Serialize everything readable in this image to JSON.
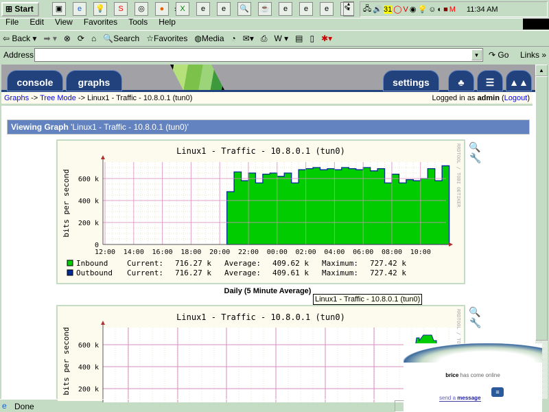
{
  "taskbar": {
    "start": "Start",
    "clock": "11:34 AM",
    "chevron": "»"
  },
  "menu": [
    "File",
    "Edit",
    "View",
    "Favorites",
    "Tools",
    "Help"
  ],
  "toolbar": {
    "back": "Back",
    "search": "Search",
    "favorites": "Favorites",
    "media": "Media"
  },
  "address": {
    "label": "Address",
    "value": "",
    "go": "Go",
    "links": "Links"
  },
  "tabs": {
    "console": "console",
    "graphs": "graphs",
    "settings": "settings"
  },
  "breadcrumb": {
    "graphs": "Graphs",
    "sep": "->",
    "tree": "Tree Mode",
    "current": "Linux1 - Traffic - 10.8.0.1 (tun0)",
    "logged_prefix": "Logged in as",
    "user": "admin",
    "logout": "Logout"
  },
  "viewing": {
    "label": "Viewing Graph",
    "title": "'Linux1 - Traffic - 10.8.0.1 (tun0)'"
  },
  "graph1": {
    "caption": "Daily (5 Minute Average)",
    "watermark": "RRDTOOL / TOBI OETIKER"
  },
  "tooltip": "Linux1 - Traffic - 10.8.0.1 (tun0)",
  "popup": {
    "user": "brice",
    "text": "has come online",
    "send": "send a",
    "message": "message"
  },
  "status": {
    "text": "Done"
  },
  "colors": {
    "inbound": "#00cc00",
    "outbound": "#002a97",
    "header_bar": "#6383c0",
    "tab": "#22427e"
  },
  "chart_data": [
    {
      "type": "area",
      "title": "Linux1 - Traffic - 10.8.0.1 (tun0)",
      "ylabel": "bits per second",
      "yticks": [
        "0",
        "200 k",
        "400 k",
        "600 k"
      ],
      "ylim": [
        0,
        750000
      ],
      "xticks": [
        "12:00",
        "14:00",
        "16:00",
        "18:00",
        "20:00",
        "22:00",
        "00:00",
        "02:00",
        "04:00",
        "06:00",
        "08:00",
        "10:00"
      ],
      "x_start": "20:30",
      "x_step_minutes": 30,
      "series": [
        {
          "name": "Inbound",
          "values": [
            480,
            660,
            580,
            650,
            560,
            640,
            650,
            620,
            650,
            560,
            680,
            690,
            700,
            680,
            690,
            680,
            700,
            690,
            680,
            700,
            670,
            690,
            560,
            640,
            560,
            590,
            580,
            600,
            690,
            580,
            716
          ]
        }
      ],
      "legend": [
        {
          "name": "Inbound",
          "current": "716.27 k",
          "average": "409.62 k",
          "maximum": "727.42 k"
        },
        {
          "name": "Outbound",
          "current": "716.27 k",
          "average": "409.61 k",
          "maximum": "727.42 k"
        }
      ],
      "legend_labels": {
        "current": "Current:",
        "average": "Average:",
        "maximum": "Maximum:"
      }
    },
    {
      "type": "area",
      "title": "Linux1 - Traffic - 10.8.0.1 (tun0)",
      "ylabel": "bits per second",
      "yticks": [
        "200 k",
        "400 k",
        "600 k"
      ]
    }
  ]
}
